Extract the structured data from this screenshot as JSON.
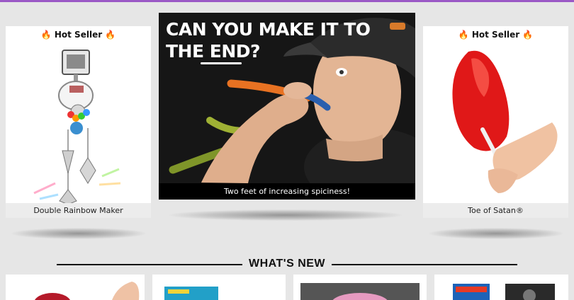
{
  "products_left": {
    "badge": "🔥 Hot Seller 🔥",
    "name": "Double Rainbow Maker"
  },
  "products_right": {
    "badge": "🔥 Hot Seller 🔥",
    "name": "Toe of Satan®"
  },
  "hero": {
    "headline_line1": "CAN YOU MAKE IT TO",
    "headline_line2_a": "THE ",
    "headline_line2_b": "END?",
    "caption": "Two feet of increasing spiciness!"
  },
  "section": {
    "title": "WHAT'S NEW"
  },
  "colors": {
    "accent": "#9b59c6",
    "background": "#e6e6e6"
  }
}
